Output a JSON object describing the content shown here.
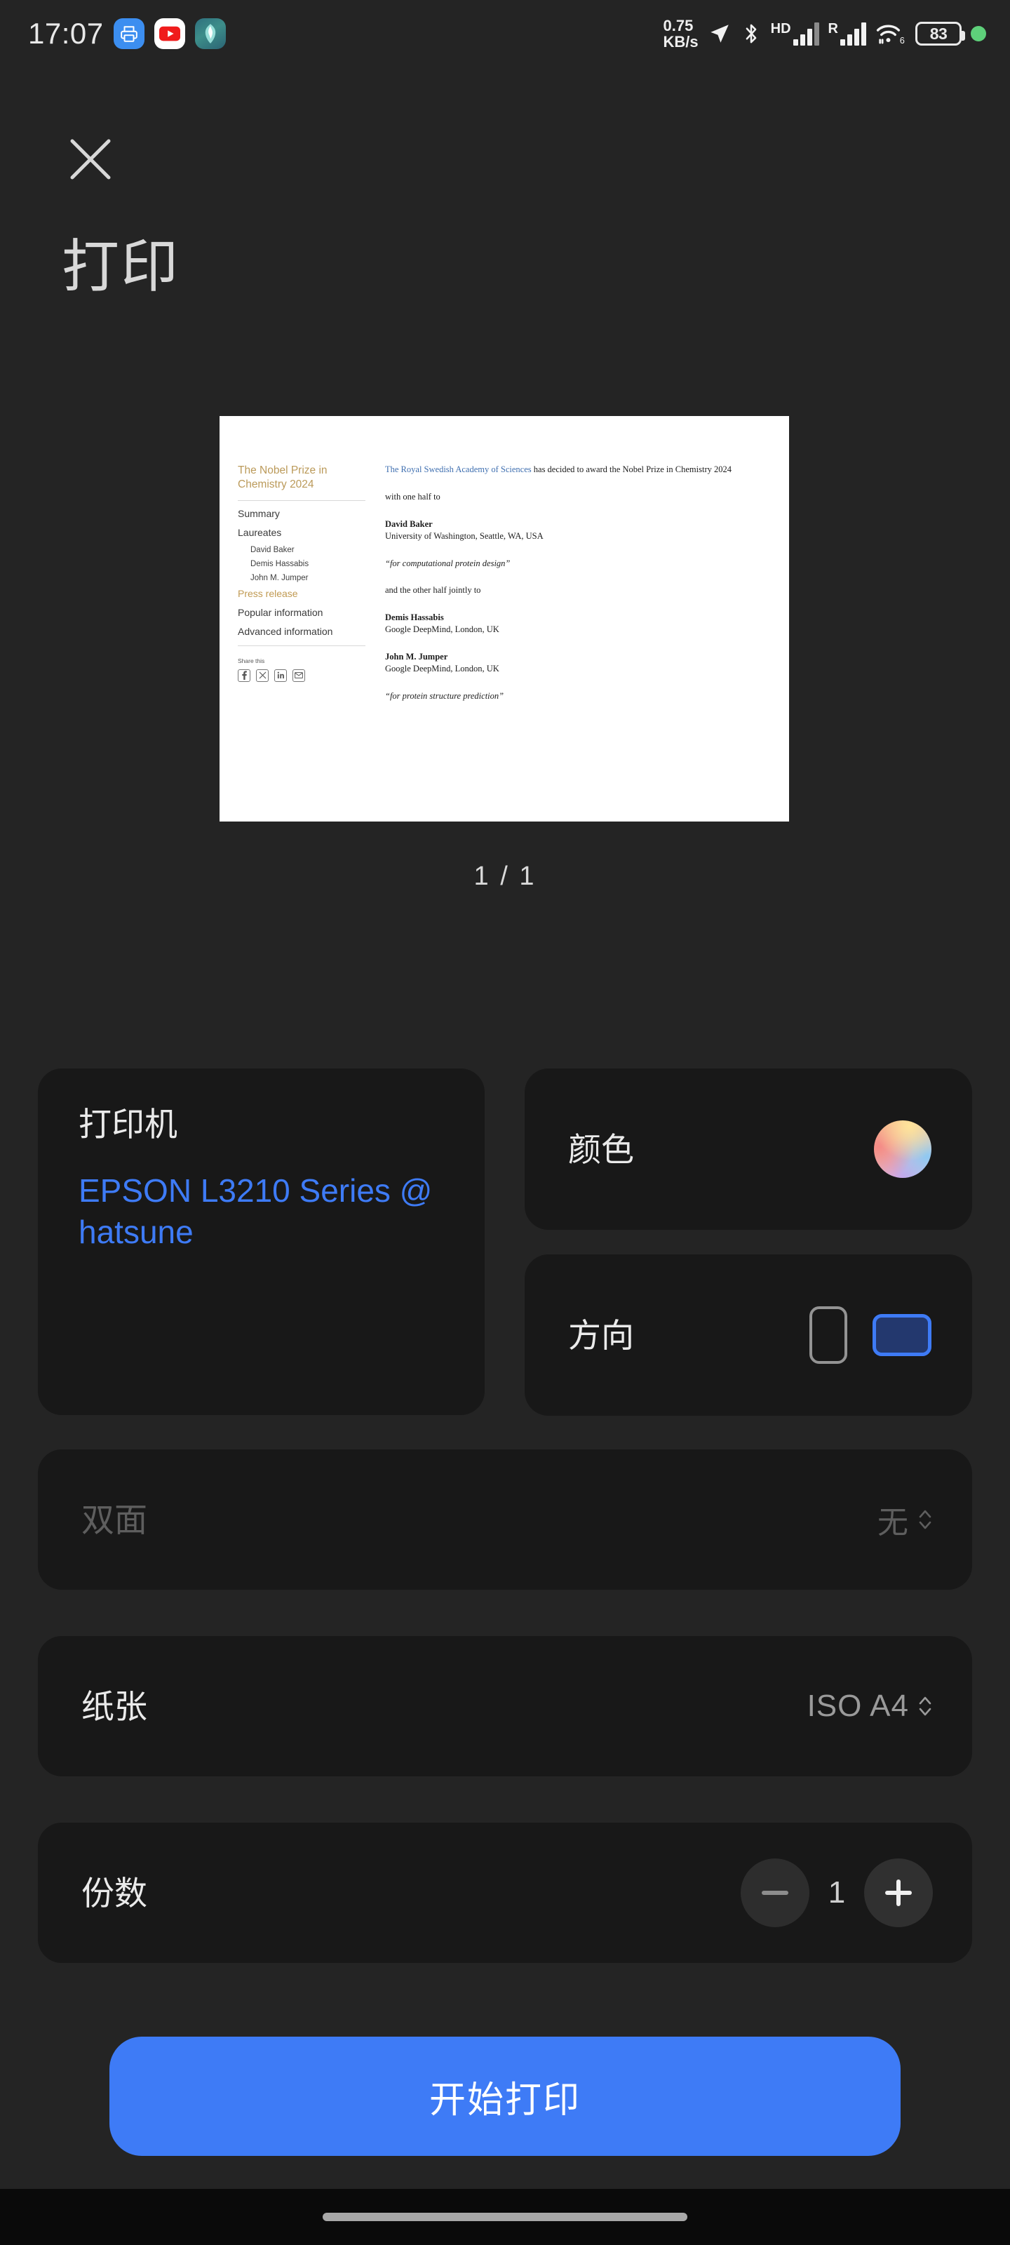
{
  "status_bar": {
    "time": "17:07",
    "notification_icons": [
      "printer-app-icon",
      "youtube-app-icon",
      "security-app-icon"
    ],
    "net_speed_value": "0.75",
    "net_speed_unit": "KB/s",
    "right_icons": [
      "location-icon",
      "bluetooth-icon",
      "hd-icon",
      "signal-1-icon",
      "roaming-icon",
      "signal-2-icon",
      "wifi-6-icon"
    ],
    "hd_label": "HD",
    "roaming_label": "R",
    "wifi_generation": "6",
    "battery_percent": "83",
    "recording_dot": "green-dot"
  },
  "header": {
    "close_icon": "close-icon",
    "title": "打印"
  },
  "preview": {
    "page_indicator": "1 / 1",
    "document": {
      "site_title": "The Nobel Prize in Chemistry 2024",
      "nav": [
        {
          "label": "Summary",
          "level": "top",
          "active": false
        },
        {
          "label": "Laureates",
          "level": "top",
          "active": false
        },
        {
          "label": "David Baker",
          "level": "sub",
          "active": false
        },
        {
          "label": "Demis Hassabis",
          "level": "sub",
          "active": false
        },
        {
          "label": "John M. Jumper",
          "level": "sub",
          "active": false
        },
        {
          "label": "Press release",
          "level": "top",
          "active": true
        },
        {
          "label": "Popular information",
          "level": "top",
          "active": false
        },
        {
          "label": "Advanced information",
          "level": "top",
          "active": false
        }
      ],
      "share_label": "Share this",
      "share_icons": [
        "facebook-icon",
        "x-twitter-icon",
        "linkedin-icon",
        "email-icon"
      ],
      "body": {
        "intro_link": "The Royal Swedish Academy of Sciences",
        "intro_rest": " has decided to award the Nobel Prize in Chemistry 2024",
        "half_one": "with one half to",
        "laureate_1_name": "David Baker",
        "laureate_1_affiliation": "University of Washington, Seattle, WA, USA",
        "laureate_1_citation": "“for computational protein design”",
        "half_two": "and the other half jointly to",
        "laureate_2_name": "Demis Hassabis",
        "laureate_2_affiliation": "Google DeepMind, London, UK",
        "laureate_3_name": "John M. Jumper",
        "laureate_3_affiliation": "Google DeepMind, London, UK",
        "laureate_23_citation": "“for protein structure prediction”"
      }
    }
  },
  "options": {
    "printer": {
      "label": "打印机",
      "value": "EPSON L3210 Series @ hatsune"
    },
    "color": {
      "label": "颜色",
      "swatch": "color-gradient-swatch"
    },
    "orientation": {
      "label": "方向",
      "portrait_icon": "portrait-icon",
      "landscape_icon": "landscape-icon",
      "selected": "landscape"
    },
    "duplex": {
      "label": "双面",
      "value": "无",
      "disabled": true
    },
    "paper": {
      "label": "纸张",
      "value": "ISO A4",
      "disabled": false
    },
    "copies": {
      "label": "份数",
      "value": "1",
      "minus_icon": "minus-icon",
      "plus_icon": "plus-icon"
    }
  },
  "print_button": {
    "label": "开始打印"
  },
  "colors": {
    "background": "#242424",
    "card": "#181818",
    "accent_blue": "#3e7bf6",
    "nobel_gold": "#bb9a5a",
    "text_primary": "#eaeaea",
    "text_dim": "#5e5e5e",
    "battery_green": "#5ed07a"
  }
}
